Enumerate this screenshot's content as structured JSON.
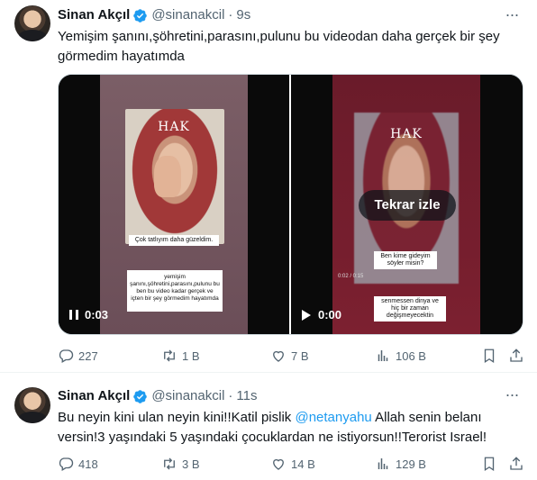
{
  "tweets": [
    {
      "author": {
        "name": "Sinan Akçıl",
        "handle": "@sinanakcil"
      },
      "separator": "·",
      "time": "9s",
      "text": "Yemişim şanını,şöhretini,parasını,pulunu bu videodan daha gerçek bir şey görmedim hayatımda",
      "media": {
        "video1": {
          "watermark": "HAK",
          "caption_top": "Çok tatlıyım daha güzeldim.",
          "caption_bottom": "yemişim şanını,şöhretini,parasını,pulunu bu ben bu video kadar gerçek ve içten bir şey görmedim hayatımda",
          "state": "pause",
          "timestamp": "0:03"
        },
        "video2": {
          "watermark": "HAK",
          "caption_top": "Ben kime gideyim söyler misin?",
          "caption_bottom": "senmessen dinya ve hiç bir zaman değişmeyecektin",
          "scrub_time": "0:02 / 0:15",
          "replay_label": "Tekrar izle",
          "state": "play",
          "timestamp": "0:00"
        }
      },
      "stats": {
        "replies": "227",
        "reposts": "1 B",
        "likes": "7 B",
        "views": "106 B"
      }
    },
    {
      "author": {
        "name": "Sinan Akçıl",
        "handle": "@sinanakcil"
      },
      "separator": "·",
      "time": "11s",
      "text_before": "Bu neyin kini ulan neyin kini!!Katil pislik ",
      "mention": "@netanyahu",
      "text_after": " Allah senin belanı versin!3 yaşındaki 5 yaşındaki çocuklardan ne istiyorsun!!Terorist Israel!",
      "stats": {
        "replies": "418",
        "reposts": "3 B",
        "likes": "14 B",
        "views": "129 B"
      }
    }
  ],
  "colors": {
    "text": "#0f1419",
    "secondary": "#536471",
    "accent": "#1d9bf0",
    "divider": "#eff3f4"
  },
  "icons": [
    "verified-badge-icon",
    "more-icon",
    "reply-icon",
    "retweet-icon",
    "like-icon",
    "views-icon",
    "bookmark-icon",
    "share-icon",
    "play-icon",
    "pause-icon"
  ]
}
